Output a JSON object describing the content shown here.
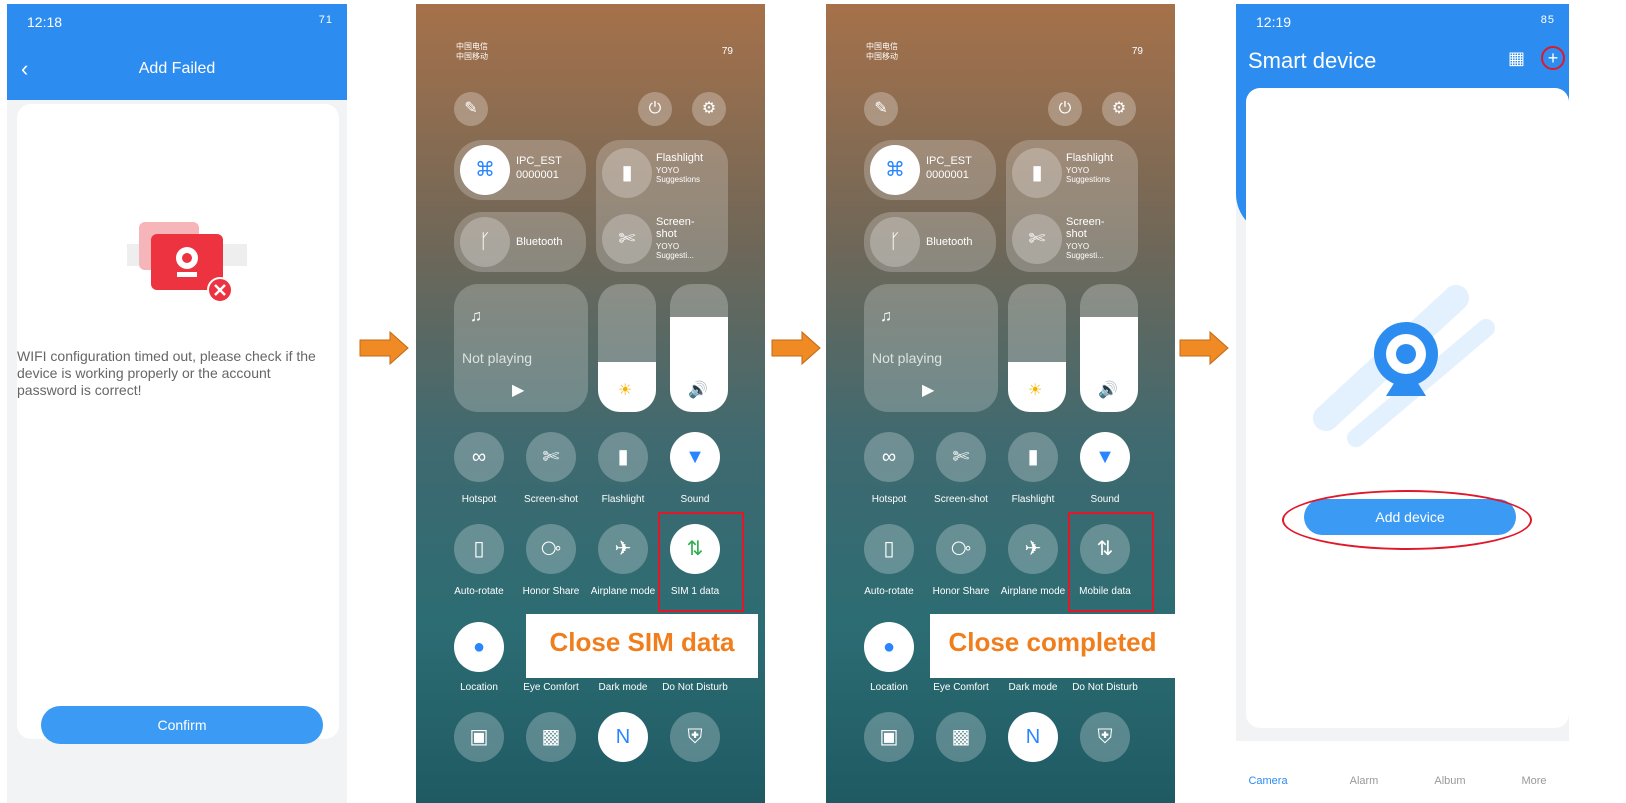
{
  "panel1": {
    "status_time": "12:18",
    "status_battery": "71",
    "header_title": "Add Failed",
    "message": "WIFI configuration timed out, please check if the device is working properly or the account password is correct!",
    "confirm_label": "Confirm"
  },
  "panel2": {
    "carrier": "中国电信\n中国移动",
    "status_battery": "79",
    "wifi_name": "IPC_EST 0000001",
    "flashlight_title": "Flashlight",
    "flashlight_sub": "YOYO Suggestions",
    "bluetooth": "Bluetooth",
    "screenshot_title": "Screen-shot",
    "screenshot_sub": "YOYO Suggesti...",
    "not_playing": "Not playing",
    "row1": [
      "Hotspot",
      "Screen-shot",
      "Flashlight",
      "Sound"
    ],
    "row2": [
      "Auto-rotate",
      "Honor Share",
      "Airplane mode",
      "SIM 1 data"
    ],
    "row3": [
      "Location",
      "Eye Comfort",
      "Dark mode",
      "Do Not Disturb"
    ],
    "overlay": "Close SIM data"
  },
  "panel3": {
    "carrier": "中国电信\n中国移动",
    "status_battery": "79",
    "wifi_name": "IPC_EST 0000001",
    "flashlight_title": "Flashlight",
    "flashlight_sub": "YOYO Suggestions",
    "bluetooth": "Bluetooth",
    "screenshot_title": "Screen-shot",
    "screenshot_sub": "YOYO Suggesti...",
    "not_playing": "Not playing",
    "row1": [
      "Hotspot",
      "Screen-shot",
      "Flashlight",
      "Sound"
    ],
    "row2": [
      "Auto-rotate",
      "Honor Share",
      "Airplane mode",
      "Mobile data"
    ],
    "row3": [
      "Location",
      "Eye Comfort",
      "Dark mode",
      "Do Not Disturb"
    ],
    "overlay": "Close completed"
  },
  "panel4": {
    "status_time": "12:19",
    "status_battery": "85",
    "title": "Smart device",
    "add_device_label": "Add device",
    "nav": [
      "Camera",
      "Alarm",
      "Album",
      "More"
    ]
  },
  "colors": {
    "accent": "#2d8cf0",
    "arrow": "#f08a24",
    "highlight": "#e0192a",
    "overlay_text": "#f07e1c"
  }
}
